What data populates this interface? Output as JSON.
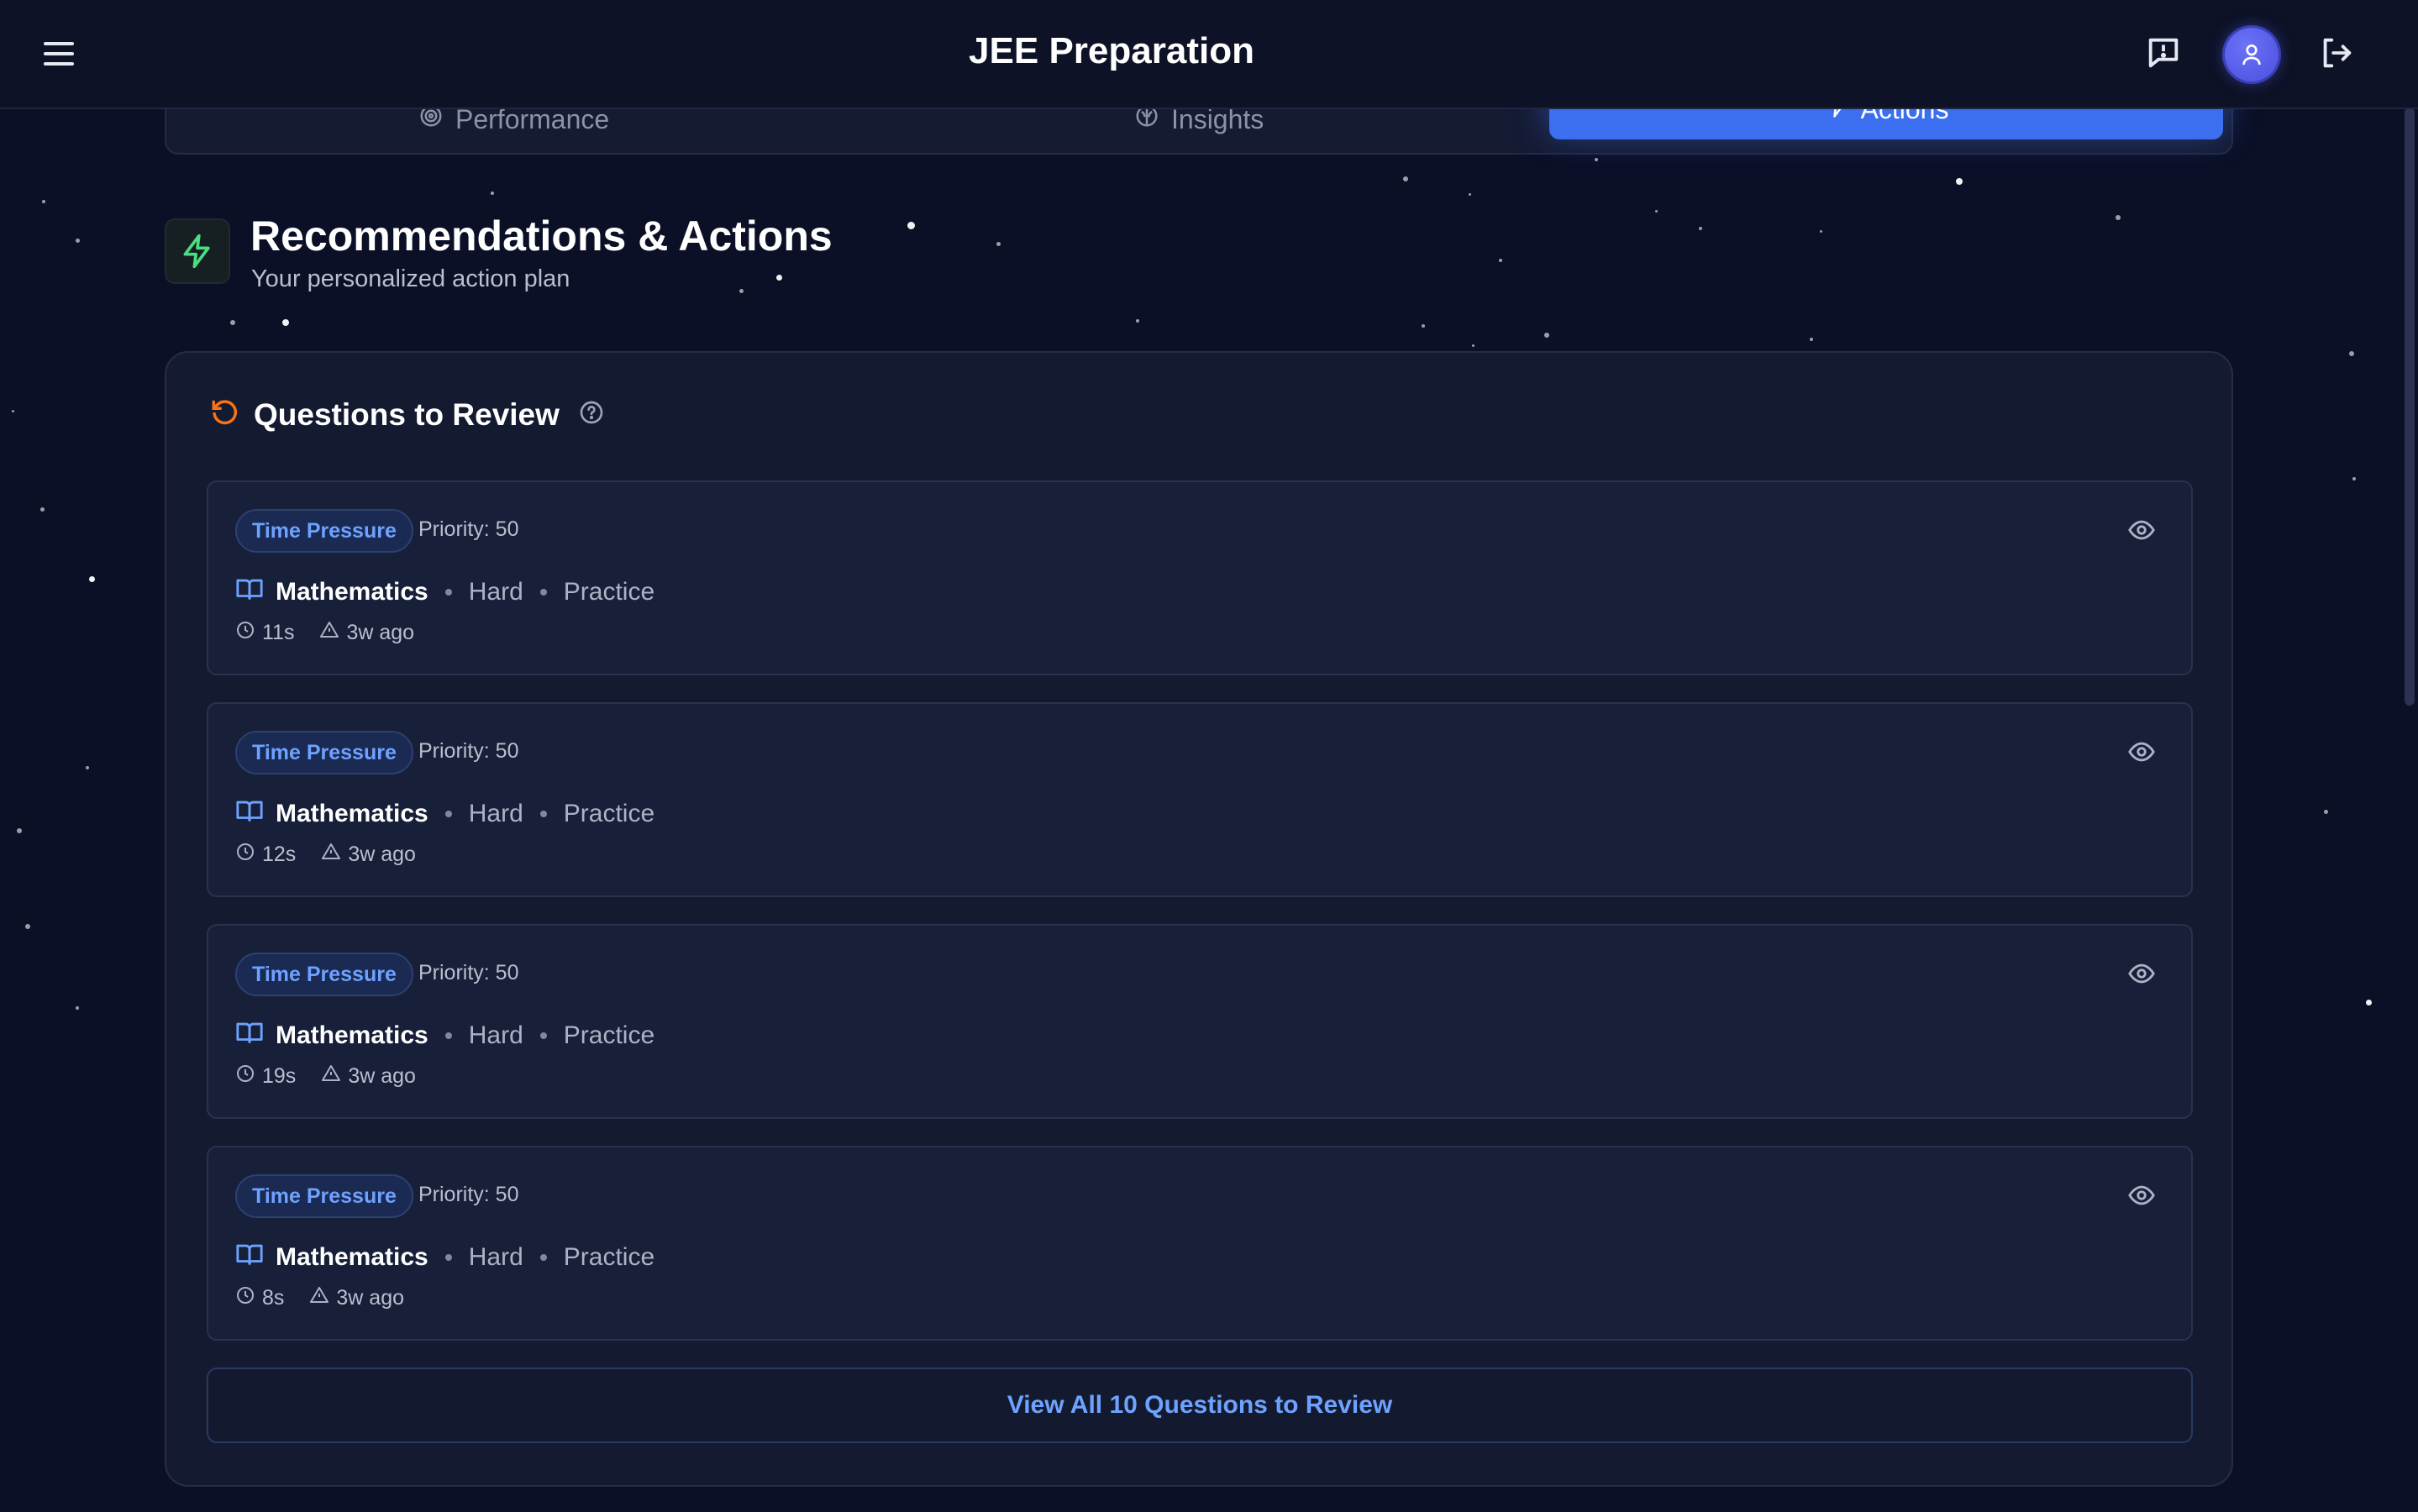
{
  "header": {
    "title": "JEE Preparation",
    "menu_icon": "hamburger-menu-icon",
    "feedback_icon": "message-alert-icon",
    "avatar_icon": "user-icon",
    "logout_icon": "logout-icon"
  },
  "tabs": [
    {
      "label": "Performance",
      "icon": "target-icon",
      "active": false
    },
    {
      "label": "Insights",
      "icon": "brain-icon",
      "active": false
    },
    {
      "label": "Actions",
      "icon": "zap-icon",
      "active": true
    }
  ],
  "section": {
    "title": "Recommendations & Actions",
    "subtitle": "Your personalized action plan",
    "icon": "zap-icon"
  },
  "review": {
    "title": "Questions to Review",
    "items": [
      {
        "tag": "Time Pressure",
        "priority": "Priority: 50",
        "subject": "Mathematics",
        "difficulty": "Hard",
        "mode": "Practice",
        "time": "11s",
        "ago": "3w ago"
      },
      {
        "tag": "Time Pressure",
        "priority": "Priority: 50",
        "subject": "Mathematics",
        "difficulty": "Hard",
        "mode": "Practice",
        "time": "12s",
        "ago": "3w ago"
      },
      {
        "tag": "Time Pressure",
        "priority": "Priority: 50",
        "subject": "Mathematics",
        "difficulty": "Hard",
        "mode": "Practice",
        "time": "19s",
        "ago": "3w ago"
      },
      {
        "tag": "Time Pressure",
        "priority": "Priority: 50",
        "subject": "Mathematics",
        "difficulty": "Hard",
        "mode": "Practice",
        "time": "8s",
        "ago": "3w ago"
      }
    ],
    "view_all_label": "View All 10 Questions to Review"
  },
  "colors": {
    "background": "#0b1027",
    "accent": "#3b6ff0",
    "badge_text": "#6ea2ff",
    "section_icon": "#4ade80",
    "review_icon": "#f97316"
  }
}
